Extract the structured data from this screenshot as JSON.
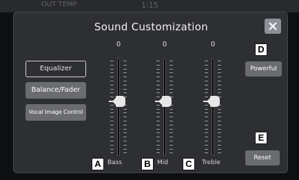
{
  "statusbar": {
    "left_text": "OUT TEMP",
    "clock": "1:15"
  },
  "dialog": {
    "title": "Sound Customization"
  },
  "side_buttons": [
    "Equalizer",
    "Balance/Fader",
    "Vocal Image Control"
  ],
  "sliders": [
    {
      "label": "Bass",
      "value": "0",
      "callout": "A"
    },
    {
      "label": "Mid",
      "value": "0",
      "callout": "B"
    },
    {
      "label": "Treble",
      "value": "0",
      "callout": "C"
    }
  ],
  "right_buttons": {
    "powerful_label": "Powerful",
    "reset_label": "Reset"
  },
  "callouts": {
    "powerful": "D",
    "reset": "E"
  },
  "colors": {
    "panel": "#2e2f33",
    "button": "#6a6c71",
    "knob": "#e7e7e7"
  }
}
